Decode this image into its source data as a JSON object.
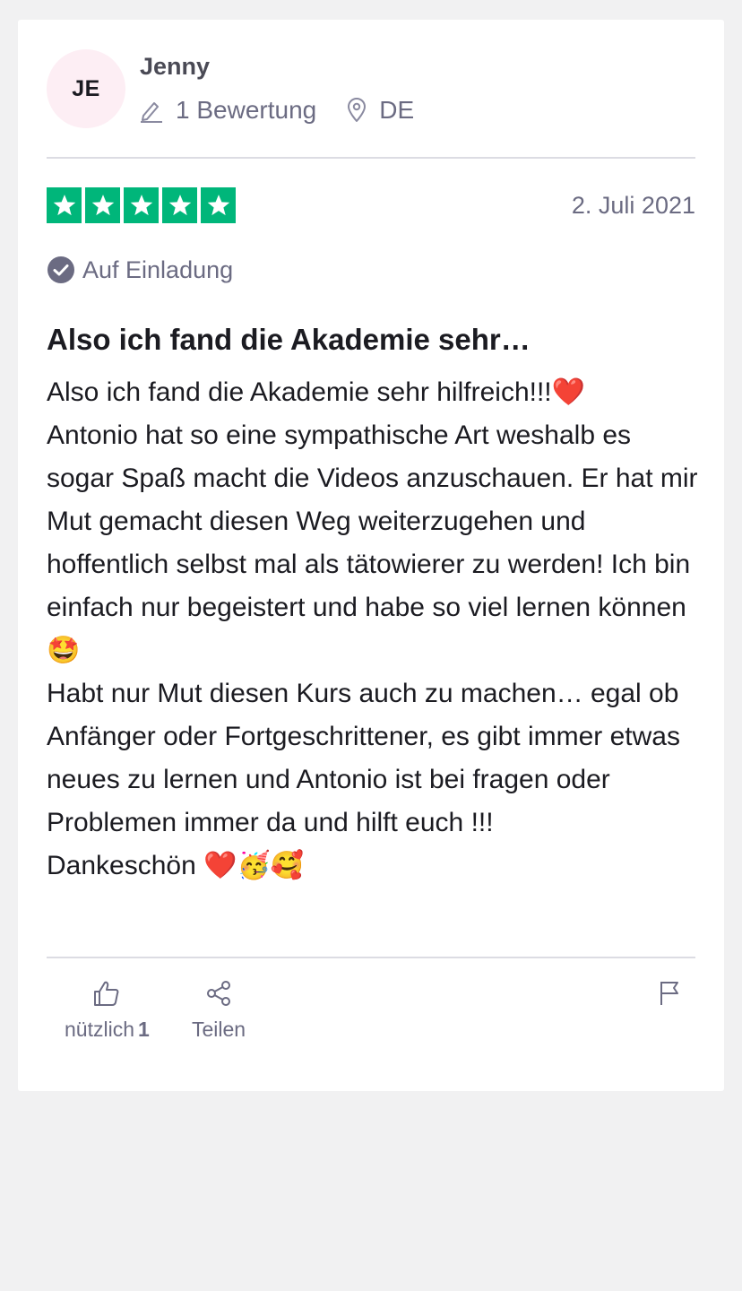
{
  "reviewer": {
    "initials": "JE",
    "name": "Jenny",
    "review_count": "1 Bewertung",
    "country": "DE",
    "avatar_color": "#fdeef4"
  },
  "review": {
    "stars": 5,
    "star_color": "#00b67a",
    "date": "2. Juli 2021",
    "badge": "Auf Einladung",
    "title": "Also ich fand die Akademie sehr…",
    "body": "Also ich fand die Akademie sehr hilfreich!!!❤️\nAntonio hat so eine sympathische Art weshalb es sogar Spaß macht die Videos anzuschauen. Er hat mir Mut gemacht diesen Weg weiterzugehen und hoffentlich selbst mal als tätowierer zu werden! Ich bin einfach nur begeistert und habe so viel lernen können🤩\nHabt nur Mut diesen Kurs auch zu machen… egal ob Anfänger oder Fortgeschrittener, es gibt immer etwas neues zu lernen und Antonio ist bei fragen oder Problemen immer da und hilft euch !!!\nDankeschön ❤️🥳🥰"
  },
  "actions": {
    "useful_label": "nützlich",
    "useful_count": "1",
    "share_label": "Teilen"
  },
  "icons": {
    "pencil": "pencil-icon",
    "location": "location-pin-icon",
    "check": "check-circle-icon",
    "thumbs_up": "thumbs-up-icon",
    "share": "share-icon",
    "flag": "flag-icon"
  }
}
